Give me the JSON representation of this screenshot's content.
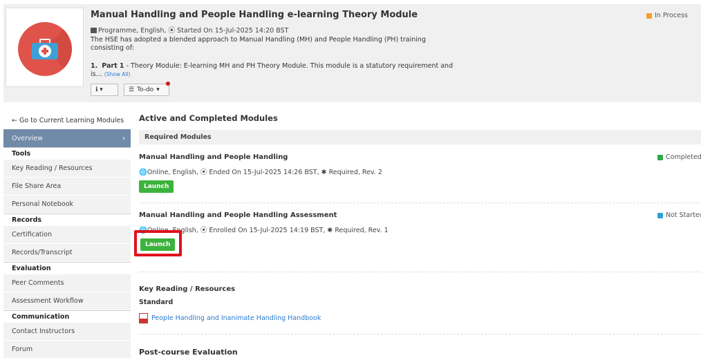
{
  "header": {
    "title": "Manual Handling and People Handling e-learning Theory Module",
    "meta": "Programme, English, ⦿ Started On 15-Jul-2025 14:20 BST",
    "description": "The HSE has adopted a blended approach to Manual Handling (MH) and People Handling (PH) training consisting of:",
    "part_number": "1.",
    "part_label": "Part 1",
    "part_text": " - Theory Module: E-learning MH and PH Theory Module. This module is a statutory requirement and is...",
    "show_all": "(Show All)",
    "info_button": "ℹ ▾",
    "todo_button": "To-do",
    "status": "In Process",
    "status_color": "#f0a030"
  },
  "sidebar": {
    "back": "← Go to Current Learning Modules",
    "active": "Overview",
    "sections": [
      {
        "heading": "Tools",
        "items": [
          "Key Reading / Resources",
          "File Share Area",
          "Personal Notebook"
        ]
      },
      {
        "heading": "Records",
        "items": [
          "Certification",
          "Records/Transcript"
        ]
      },
      {
        "heading": "Evaluation",
        "items": [
          "Peer Comments",
          "Assessment Workflow"
        ]
      },
      {
        "heading": "Communication",
        "items": [
          "Contact Instructors",
          "Forum"
        ]
      }
    ]
  },
  "main": {
    "title": "Active and Completed Modules",
    "required_label": "Required Modules",
    "modules": [
      {
        "title": "Manual Handling and People Handling",
        "meta": "Online, English, ⦿ Ended On 15-Jul-2025 14:26 BST, ✱ Required, Rev. 2",
        "launch": "Launch",
        "status": "Completed",
        "status_color": "#2ea84a"
      },
      {
        "title": "Manual Handling and People Handling Assessment",
        "meta": "Online, English, ⦿ Enrolled On 15-Jul-2025 14:19 BST, ✱ Required, Rev. 1",
        "launch": "Launch",
        "status": "Not Started",
        "status_color": "#2aa3d6"
      }
    ],
    "key_reading": {
      "title": "Key Reading / Resources",
      "sub": "Standard",
      "file": "People Handling and Inanimate Handling Handbook"
    },
    "post_course": "Post-course Evaluation"
  }
}
